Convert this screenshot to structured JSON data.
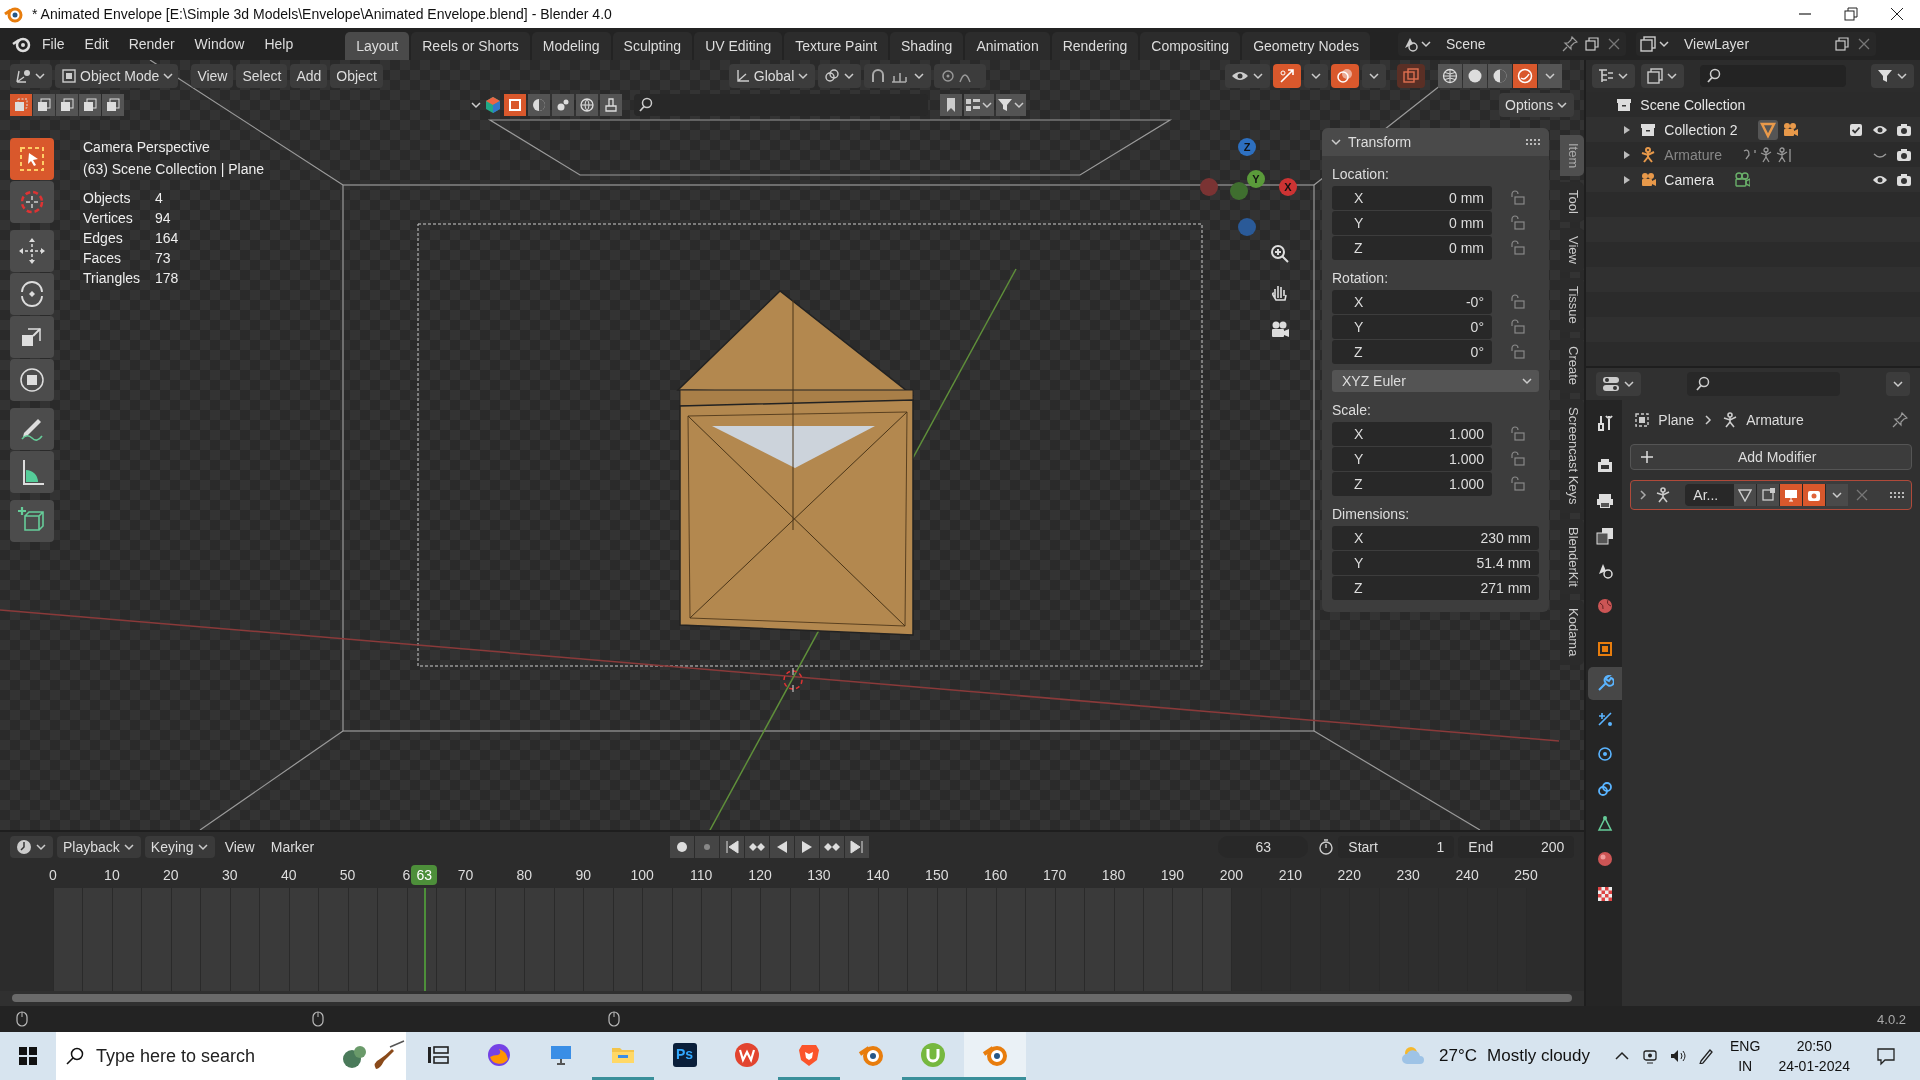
{
  "window": {
    "title": "* Animated Envelope [E:\\Simple 3d Models\\Envelope\\Animated Envelope.blend] - Blender 4.0"
  },
  "window_controls": [
    {
      "kind": "minimize"
    },
    {
      "kind": "restore"
    },
    {
      "kind": "close"
    }
  ],
  "menu": [
    "File",
    "Edit",
    "Render",
    "Window",
    "Help"
  ],
  "workspaces": [
    {
      "label": "Layout",
      "selected": true
    },
    {
      "label": "Reels or Shorts",
      "selected": false
    },
    {
      "label": "Modeling",
      "selected": false
    },
    {
      "label": "Sculpting",
      "selected": false
    },
    {
      "label": "UV Editing",
      "selected": false
    },
    {
      "label": "Texture Paint",
      "selected": false
    },
    {
      "label": "Shading",
      "selected": false
    },
    {
      "label": "Animation",
      "selected": false
    },
    {
      "label": "Rendering",
      "selected": false
    },
    {
      "label": "Compositing",
      "selected": false
    },
    {
      "label": "Geometry Nodes",
      "selected": false
    }
  ],
  "scene": "Scene",
  "view_layer": "ViewLayer",
  "viewport": {
    "mode": "Object Mode",
    "menus": [
      "View",
      "Select",
      "Add",
      "Object"
    ],
    "orientation": "Global",
    "options": "Options",
    "select_modes": [
      {
        "selected": true
      },
      {
        "selected": false
      },
      {
        "selected": false
      },
      {
        "selected": false
      },
      {
        "selected": false
      }
    ],
    "shading": [
      {
        "kind": "wireframe",
        "selected": false
      },
      {
        "kind": "solid",
        "selected": false
      },
      {
        "kind": "material",
        "selected": false
      },
      {
        "kind": "rendered",
        "selected": true
      }
    ],
    "info": [
      "Camera Perspective",
      "(63) Scene Collection | Plane"
    ],
    "stats": [
      {
        "label": "Objects",
        "value": "4"
      },
      {
        "label": "Vertices",
        "value": "94"
      },
      {
        "label": "Edges",
        "value": "164"
      },
      {
        "label": "Faces",
        "value": "73"
      },
      {
        "label": "Triangles",
        "value": "178"
      }
    ],
    "tools": [
      {
        "kind": "select",
        "selected": true
      },
      {
        "kind": "cursor",
        "selected": false
      },
      {
        "kind": "move",
        "selected": false
      },
      {
        "kind": "rotate",
        "selected": false
      },
      {
        "kind": "scale",
        "selected": false
      },
      {
        "kind": "transform",
        "selected": false
      },
      {
        "kind": "annotate",
        "selected": false
      },
      {
        "kind": "measure",
        "selected": false
      },
      {
        "kind": "add_cube",
        "selected": false
      }
    ],
    "gizmo_axes": [
      "Z",
      "Y",
      "X"
    ]
  },
  "transform": {
    "title": "Transform",
    "sections": [
      {
        "kind": "vector",
        "label": "Location:",
        "lockable": true,
        "rows": [
          {
            "axis": "X",
            "value": "0 mm"
          },
          {
            "axis": "Y",
            "value": "0 mm"
          },
          {
            "axis": "Z",
            "value": "0 mm"
          }
        ]
      },
      {
        "kind": "vector",
        "label": "Rotation:",
        "lockable": true,
        "rows": [
          {
            "axis": "X",
            "value": "-0°"
          },
          {
            "axis": "Y",
            "value": "0°"
          },
          {
            "axis": "Z",
            "value": "0°"
          }
        ]
      },
      {
        "kind": "dropdown",
        "value": "XYZ Euler"
      },
      {
        "kind": "vector",
        "label": "Scale:",
        "lockable": true,
        "rows": [
          {
            "axis": "X",
            "value": "1.000"
          },
          {
            "axis": "Y",
            "value": "1.000"
          },
          {
            "axis": "Z",
            "value": "1.000"
          }
        ]
      },
      {
        "kind": "vector",
        "label": "Dimensions:",
        "lockable": false,
        "rows": [
          {
            "axis": "X",
            "value": "230 mm"
          },
          {
            "axis": "Y",
            "value": "51.4 mm"
          },
          {
            "axis": "Z",
            "value": "271 mm"
          }
        ]
      }
    ]
  },
  "sidebar_tabs": [
    {
      "label": "Item",
      "selected": true
    },
    {
      "label": "Tool",
      "selected": false
    },
    {
      "label": "View",
      "selected": false
    },
    {
      "label": "Tissue",
      "selected": false
    },
    {
      "label": "Create",
      "selected": false
    },
    {
      "label": "Screencast Keys",
      "selected": false
    },
    {
      "label": "BlenderKit",
      "selected": false
    },
    {
      "label": "Kodama",
      "selected": false
    }
  ],
  "outliner": {
    "root": "Scene Collection",
    "children": [
      {
        "kind": "collection",
        "label": "Collection 2",
        "hidden": false
      },
      {
        "kind": "armature",
        "label": "Armature",
        "hidden": true
      },
      {
        "kind": "camera",
        "label": "Camera",
        "hidden": false
      }
    ]
  },
  "properties": {
    "tabs": [
      {
        "kind": "tool",
        "selected": false
      },
      {
        "kind": "render",
        "selected": false
      },
      {
        "kind": "output",
        "selected": false
      },
      {
        "kind": "view_layer",
        "selected": false
      },
      {
        "kind": "scene",
        "selected": false
      },
      {
        "kind": "world",
        "selected": false
      },
      {
        "kind": "object",
        "selected": false
      },
      {
        "kind": "modifiers",
        "selected": true
      },
      {
        "kind": "particles",
        "selected": false
      },
      {
        "kind": "physics",
        "selected": false
      },
      {
        "kind": "constraints",
        "selected": false
      },
      {
        "kind": "data",
        "selected": false
      },
      {
        "kind": "material",
        "selected": false
      },
      {
        "kind": "texture",
        "selected": false
      }
    ],
    "breadcrumb": [
      "Plane",
      "Armature"
    ],
    "add_modifier": "Add Modifier",
    "modifiers": [
      {
        "name": "Ar...",
        "expanded": false
      }
    ]
  },
  "timeline": {
    "menus": [
      "Playback",
      "Keying",
      "View",
      "Marker"
    ],
    "current_frame": "63",
    "start_label": "Start",
    "start": "1",
    "end_label": "End",
    "end": "200",
    "ruler": [
      "0",
      "10",
      "20",
      "30",
      "40",
      "50",
      "6",
      "70",
      "80",
      "90",
      "100",
      "110",
      "120",
      "130",
      "140",
      "150",
      "160",
      "170",
      "180",
      "190",
      "200",
      "210",
      "220",
      "230",
      "240",
      "250"
    ],
    "playhead": {
      "label": "63",
      "level": 0.252
    },
    "scene_range": {
      "level": 0.8
    }
  },
  "status_bar": {
    "version": "4.0.2"
  },
  "taskbar": {
    "search_placeholder": "Type here to search",
    "apps": [
      {
        "kind": "task_view",
        "open": false,
        "selected": false
      },
      {
        "kind": "firefox",
        "open": false,
        "selected": false
      },
      {
        "kind": "display",
        "open": false,
        "selected": false
      },
      {
        "kind": "folder",
        "open": true,
        "selected": false
      },
      {
        "kind": "photoshop",
        "label": "Ps",
        "open": false,
        "selected": false
      },
      {
        "kind": "wps",
        "open": false,
        "selected": false
      },
      {
        "kind": "brave",
        "open": true,
        "selected": false
      },
      {
        "kind": "blender",
        "open": false,
        "selected": false
      },
      {
        "kind": "torrent",
        "open": true,
        "selected": false
      },
      {
        "kind": "blender",
        "open": true,
        "selected": true
      }
    ],
    "weather": {
      "temp": "27°C",
      "text": "Mostly cloudy"
    },
    "language": [
      "ENG",
      "IN"
    ],
    "time": "20:50",
    "date": "24-01-2024"
  }
}
